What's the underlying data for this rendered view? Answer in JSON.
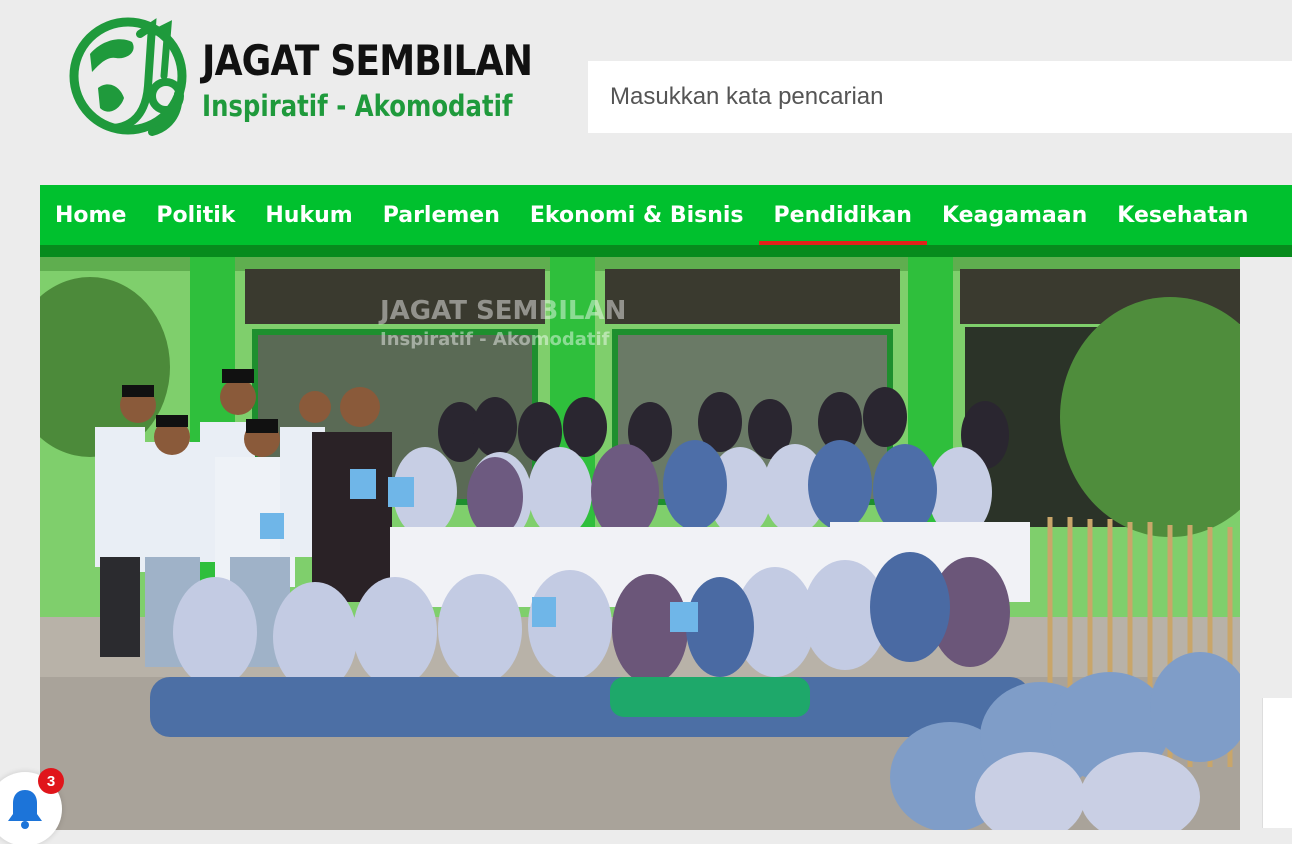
{
  "site": {
    "logo_title": "JAGAT SEMBILAN",
    "logo_tagline": "Inspiratif - Akomodatif",
    "brand_color": "#00c12e",
    "brand_dark": "#078b1d",
    "accent": "#e2231a"
  },
  "search": {
    "placeholder": "Masukkan kata pencarian"
  },
  "nav": {
    "items": [
      {
        "label": "Home"
      },
      {
        "label": "Politik"
      },
      {
        "label": "Hukum"
      },
      {
        "label": "Parlemen"
      },
      {
        "label": "Ekonomi & Bisnis"
      },
      {
        "label": "Pendidikan"
      },
      {
        "label": "Keagamaan"
      },
      {
        "label": "Kesehatan"
      }
    ],
    "active": "Pendidikan"
  },
  "hero": {
    "watermark_title": "JAGAT SEMBILAN",
    "watermark_tagline": "Inspiratif - Akomodatif"
  },
  "notification": {
    "icon": "bell-icon",
    "count": "3"
  }
}
